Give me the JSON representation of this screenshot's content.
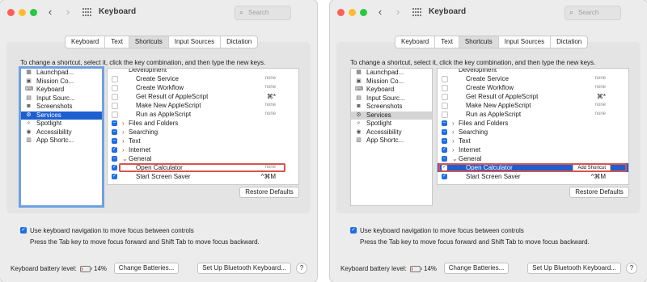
{
  "window": {
    "title": "Keyboard",
    "search_placeholder": "Search",
    "tabs": [
      "Keyboard",
      "Text",
      "Shortcuts",
      "Input Sources",
      "Dictation"
    ],
    "active_tab": "Shortcuts"
  },
  "instructions": "To change a shortcut, select it, click the key combination, and then type the new keys.",
  "categories": [
    {
      "label": "Launchpad...",
      "icon": "launchpad-icon"
    },
    {
      "label": "Mission Co...",
      "icon": "mission-control-icon"
    },
    {
      "label": "Keyboard",
      "icon": "keyboard-icon"
    },
    {
      "label": "Input Sourc...",
      "icon": "input-sources-icon"
    },
    {
      "label": "Screenshots",
      "icon": "screenshots-icon"
    },
    {
      "label": "Services",
      "icon": "gear-icon"
    },
    {
      "label": "Spotlight",
      "icon": "spotlight-icon"
    },
    {
      "label": "Accessibility",
      "icon": "accessibility-icon"
    },
    {
      "label": "App Shortc...",
      "icon": "app-shortcuts-icon"
    }
  ],
  "selected_category": "Services",
  "shortcuts_left": [
    {
      "label": "Development",
      "indent": 1,
      "check": "none",
      "keys": ""
    },
    {
      "label": "Create Service",
      "indent": 2,
      "check": "off",
      "keys": "none"
    },
    {
      "label": "Create Workflow",
      "indent": 2,
      "check": "off",
      "keys": "none"
    },
    {
      "label": "Get Result of AppleScript",
      "indent": 2,
      "check": "off",
      "keys": "⌘*"
    },
    {
      "label": "Make New AppleScript",
      "indent": 2,
      "check": "off",
      "keys": "none"
    },
    {
      "label": "Run as AppleScript",
      "indent": 2,
      "check": "off",
      "keys": "none"
    },
    {
      "label": "Files and Folders",
      "indent": 1,
      "check": "mixed",
      "chevron": "›",
      "keys": ""
    },
    {
      "label": "Searching",
      "indent": 1,
      "check": "mixed",
      "chevron": "›",
      "keys": ""
    },
    {
      "label": "Text",
      "indent": 1,
      "check": "mixed",
      "chevron": "›",
      "keys": ""
    },
    {
      "label": "Internet",
      "indent": 1,
      "check": "on",
      "chevron": "›",
      "keys": ""
    },
    {
      "label": "General",
      "indent": 1,
      "check": "mixed",
      "chevron": "⌄",
      "keys": ""
    },
    {
      "label": "Open Calculator",
      "indent": 2,
      "check": "on",
      "keys": "none",
      "highlight": "box"
    },
    {
      "label": "Start Screen Saver",
      "indent": 2,
      "check": "on",
      "keys": "^⌘M"
    }
  ],
  "shortcuts_right": [
    {
      "label": "Development",
      "indent": 1,
      "check": "none",
      "keys": ""
    },
    {
      "label": "Create Service",
      "indent": 2,
      "check": "off",
      "keys": "none"
    },
    {
      "label": "Create Workflow",
      "indent": 2,
      "check": "off",
      "keys": "none"
    },
    {
      "label": "Get Result of AppleScript",
      "indent": 2,
      "check": "off",
      "keys": "⌘*"
    },
    {
      "label": "Make New AppleScript",
      "indent": 2,
      "check": "off",
      "keys": "none"
    },
    {
      "label": "Run as AppleScript",
      "indent": 2,
      "check": "off",
      "keys": "none"
    },
    {
      "label": "Files and Folders",
      "indent": 1,
      "check": "mixed",
      "chevron": "›",
      "keys": ""
    },
    {
      "label": "Searching",
      "indent": 1,
      "check": "mixed",
      "chevron": "›",
      "keys": ""
    },
    {
      "label": "Text",
      "indent": 1,
      "check": "mixed",
      "chevron": "›",
      "keys": ""
    },
    {
      "label": "Internet",
      "indent": 1,
      "check": "on",
      "chevron": "›",
      "keys": ""
    },
    {
      "label": "General",
      "indent": 1,
      "check": "mixed",
      "chevron": "⌄",
      "keys": ""
    },
    {
      "label": "Open Calculator",
      "indent": 2,
      "check": "on",
      "keys": "",
      "highlight": "selected",
      "button": "Add Shortcut"
    },
    {
      "label": "Start Screen Saver",
      "indent": 2,
      "check": "on",
      "keys": "^⌘M"
    }
  ],
  "restore_defaults": "Restore Defaults",
  "keyboard_navigation": {
    "checked": true,
    "label": "Use keyboard navigation to move focus between controls",
    "hint": "Press the Tab key to move focus forward and Shift Tab to move focus backward."
  },
  "battery": {
    "label": "Keyboard battery level:",
    "percent_text": "14%",
    "level": 0.14
  },
  "buttons": {
    "change_batteries": "Change Batteries...",
    "bluetooth_setup": "Set Up Bluetooth Keyboard...",
    "help": "?"
  },
  "colors": {
    "accent": "#1e5fd0",
    "highlight_box": "#d9534f"
  }
}
